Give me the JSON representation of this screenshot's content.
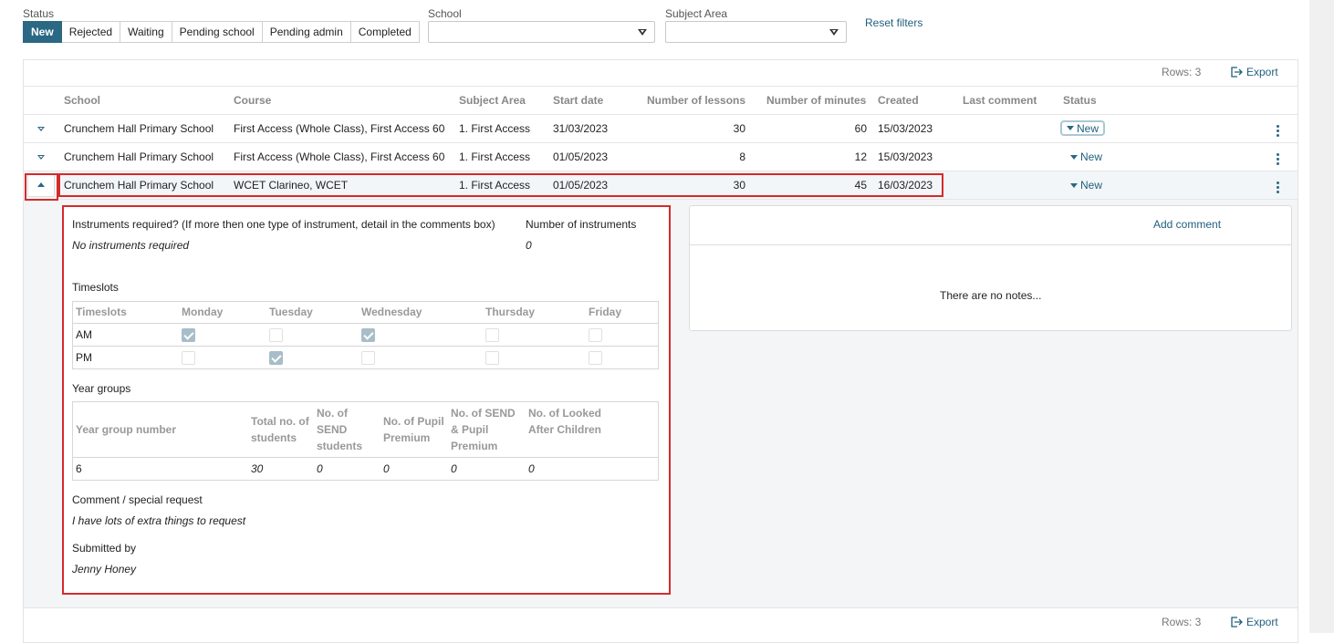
{
  "filters": {
    "status_label": "Status",
    "status_options": [
      "New",
      "Rejected",
      "Waiting",
      "Pending school",
      "Pending admin",
      "Completed"
    ],
    "status_selected": "New",
    "school_label": "School",
    "school_value": "",
    "subject_label": "Subject Area",
    "subject_value": "",
    "reset_label": "Reset filters"
  },
  "toolbar": {
    "rows_text": "Rows: 3",
    "export_label": "Export"
  },
  "footer": {
    "rows_text": "Rows: 3",
    "export_label": "Export"
  },
  "table": {
    "headers": [
      "School",
      "Course",
      "Subject Area",
      "Start date",
      "Number of lessons",
      "Number of minutes",
      "Created",
      "Last comment",
      "Status"
    ],
    "rows": [
      {
        "school": "Crunchem Hall Primary School",
        "course": "First Access (Whole Class), First Access 60",
        "subject": "1. First Access",
        "start": "31/03/2023",
        "lessons": "30",
        "minutes": "60",
        "created": "15/03/2023",
        "last_comment": "",
        "status": "New"
      },
      {
        "school": "Crunchem Hall Primary School",
        "course": "First Access (Whole Class), First Access 60",
        "subject": "1. First Access",
        "start": "01/05/2023",
        "lessons": "8",
        "minutes": "12",
        "created": "15/03/2023",
        "last_comment": "",
        "status": "New"
      },
      {
        "school": "Crunchem Hall Primary School",
        "course": "WCET Clarineo, WCET",
        "subject": "1. First Access",
        "start": "01/05/2023",
        "lessons": "30",
        "minutes": "45",
        "created": "16/03/2023",
        "last_comment": "",
        "status": "New"
      }
    ]
  },
  "detail": {
    "instruments_label": "Instruments required? (If more then one type of instrument, detail in the comments box)",
    "instruments_value": "No instruments required",
    "num_instruments_label": "Number of instruments",
    "num_instruments_value": "0",
    "timeslots_label": "Timeslots",
    "timeslots_table": {
      "headers": [
        "Timeslots",
        "Monday",
        "Tuesday",
        "Wednesday",
        "Thursday",
        "Friday"
      ],
      "rows": [
        {
          "slot": "AM",
          "checked": [
            true,
            false,
            true,
            false,
            false
          ]
        },
        {
          "slot": "PM",
          "checked": [
            false,
            true,
            false,
            false,
            false
          ]
        }
      ]
    },
    "year_groups_label": "Year groups",
    "year_groups_table": {
      "headers": [
        "Year group number",
        "Total no. of students",
        "No. of SEND students",
        "No. of Pupil Premium",
        "No. of SEND & Pupil Premium",
        "No. of Looked After Children"
      ],
      "row": [
        "6",
        "30",
        "0",
        "0",
        "0",
        "0"
      ]
    },
    "comment_label": "Comment / special request",
    "comment_value": "I have lots of extra things to request",
    "submitted_label": "Submitted by",
    "submitted_value": "Jenny Honey"
  },
  "notes": {
    "add_comment_label": "Add comment",
    "empty_text": "There are no notes..."
  },
  "colors": {
    "accent": "#2a6884",
    "highlight": "#d52b2b"
  }
}
